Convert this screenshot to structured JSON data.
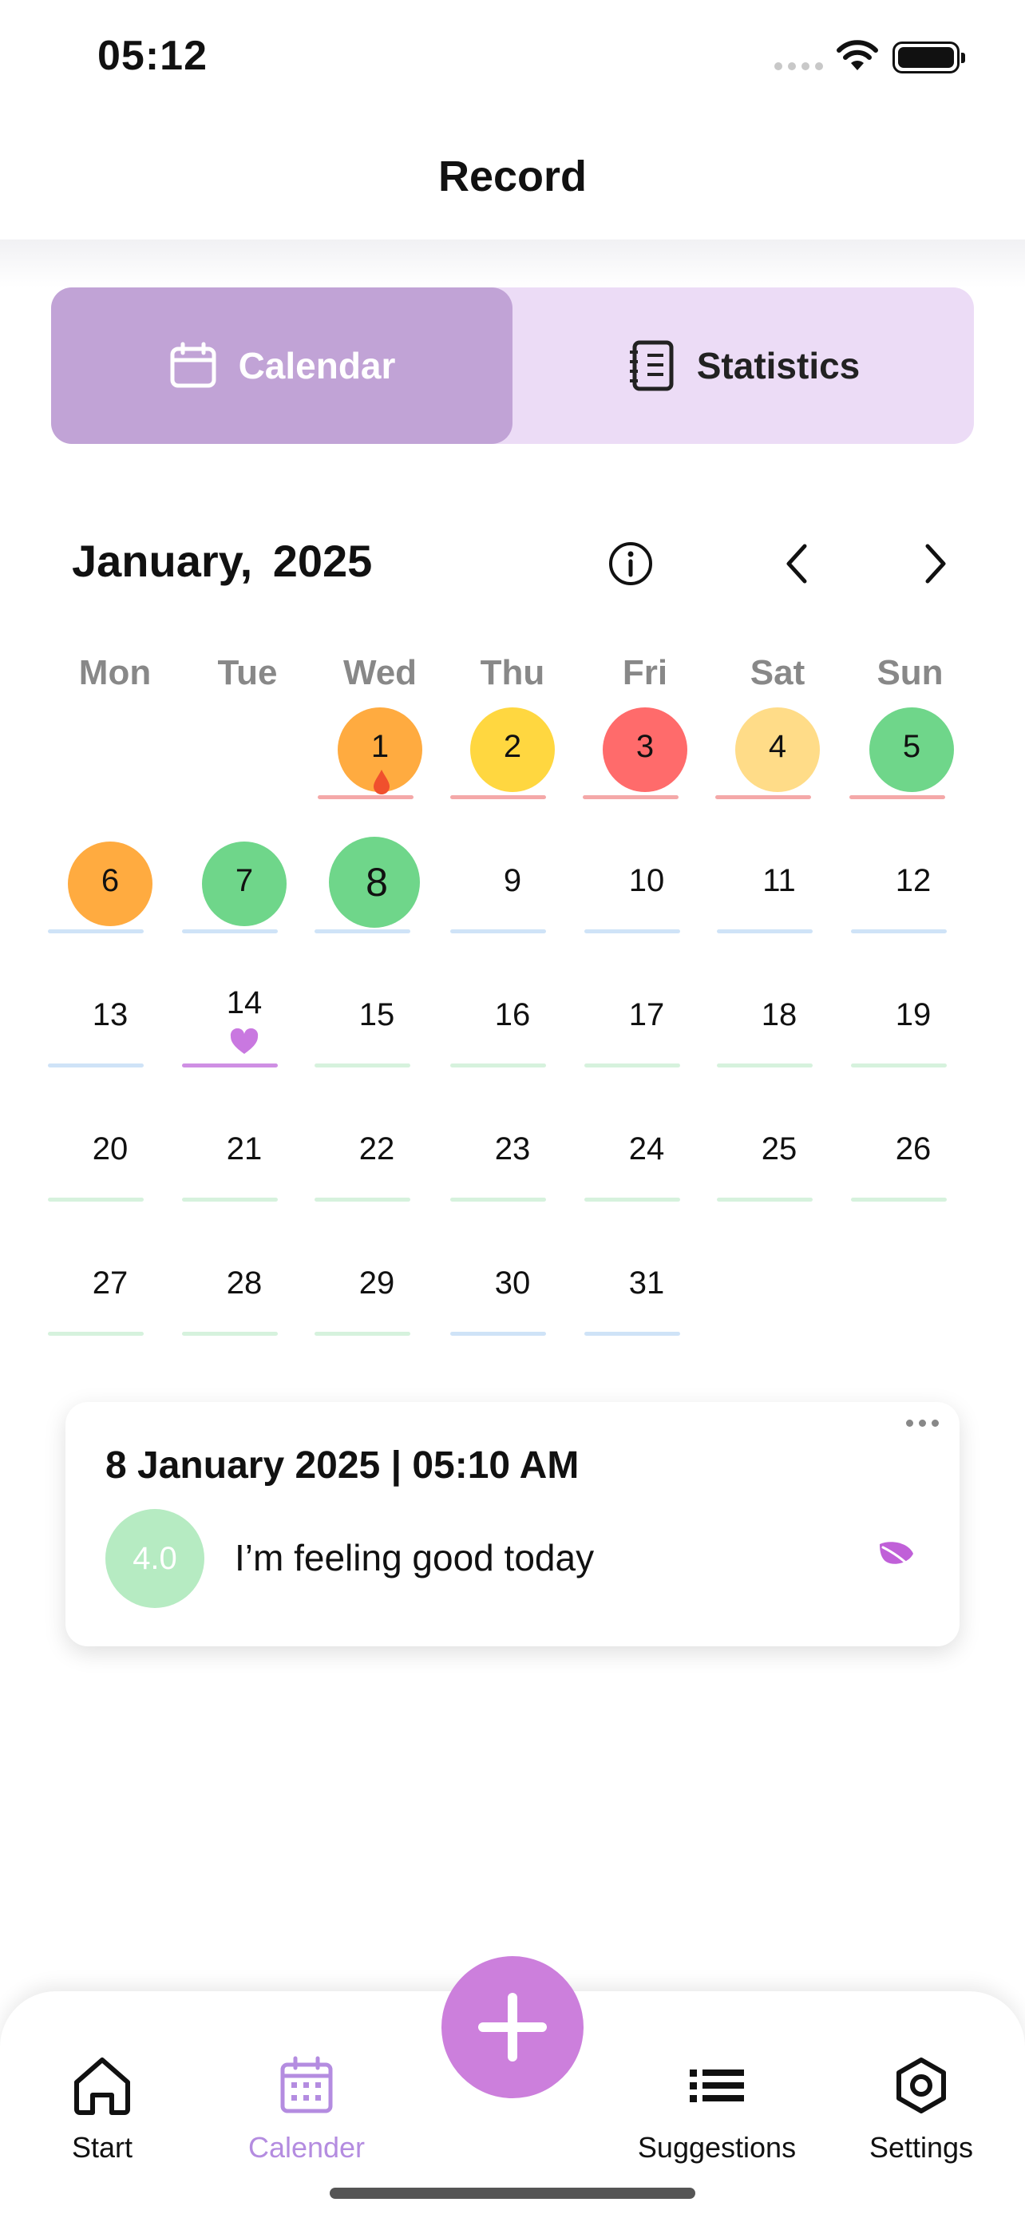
{
  "status": {
    "time": "05:12"
  },
  "header": {
    "title": "Record"
  },
  "segment": {
    "calendar_label": "Calendar",
    "statistics_label": "Statistics",
    "active": "calendar"
  },
  "calendar": {
    "month_label": "January,  2025",
    "weekdays": [
      "Mon",
      "Tue",
      "Wed",
      "Thu",
      "Fri",
      "Sat",
      "Sun"
    ],
    "days": [
      {
        "n": "1",
        "circle": "#ffab40",
        "line": "#f4a8a8",
        "drop": true
      },
      {
        "n": "2",
        "circle": "#ffd740",
        "line": "#f4a8a8"
      },
      {
        "n": "3",
        "circle": "#ff6b6b",
        "line": "#f4a8a8"
      },
      {
        "n": "4",
        "circle": "#ffdc88",
        "line": "#f4a8a8"
      },
      {
        "n": "5",
        "circle": "#6fd68a",
        "line": "#f4a8a8"
      },
      {
        "n": "6",
        "circle": "#ffab40",
        "line": "#cfe3f7"
      },
      {
        "n": "7",
        "circle": "#6fd68a",
        "line": "#cfe3f7"
      },
      {
        "n": "8",
        "circle": "#6fd68a",
        "line": "#cfe3f7",
        "selected": true
      },
      {
        "n": "9",
        "line": "#cfe3f7"
      },
      {
        "n": "10",
        "line": "#cfe3f7"
      },
      {
        "n": "11",
        "line": "#cfe3f7"
      },
      {
        "n": "12",
        "line": "#cfe3f7"
      },
      {
        "n": "13",
        "line": "#cfe3f7"
      },
      {
        "n": "14",
        "line": "#cf8fe4",
        "heart": true
      },
      {
        "n": "15",
        "line": "#d6f2dd"
      },
      {
        "n": "16",
        "line": "#d6f2dd"
      },
      {
        "n": "17",
        "line": "#d6f2dd"
      },
      {
        "n": "18",
        "line": "#d6f2dd"
      },
      {
        "n": "19",
        "line": "#d6f2dd"
      },
      {
        "n": "20",
        "line": "#d6f2dd"
      },
      {
        "n": "21",
        "line": "#d6f2dd"
      },
      {
        "n": "22",
        "line": "#d6f2dd"
      },
      {
        "n": "23",
        "line": "#d6f2dd"
      },
      {
        "n": "24",
        "line": "#d6f2dd"
      },
      {
        "n": "25",
        "line": "#d6f2dd"
      },
      {
        "n": "26",
        "line": "#d6f2dd"
      },
      {
        "n": "27",
        "line": "#d6f2dd"
      },
      {
        "n": "28",
        "line": "#d6f2dd"
      },
      {
        "n": "29",
        "line": "#d6f2dd"
      },
      {
        "n": "30",
        "line": "#cfe3f7"
      },
      {
        "n": "31",
        "line": "#cfe3f7"
      }
    ]
  },
  "entry": {
    "datetime": "8 January 2025 | 05:10 AM",
    "score": "4.0",
    "note": "I’m feeling good today"
  },
  "tabs": {
    "start": "Start",
    "calendar": "Calender",
    "suggestions": "Suggestions",
    "settings": "Settings"
  },
  "colors": {
    "accent": "#cc7fdc",
    "segment_active": "#c1a3d6",
    "segment_bg": "#ecdcf6"
  }
}
